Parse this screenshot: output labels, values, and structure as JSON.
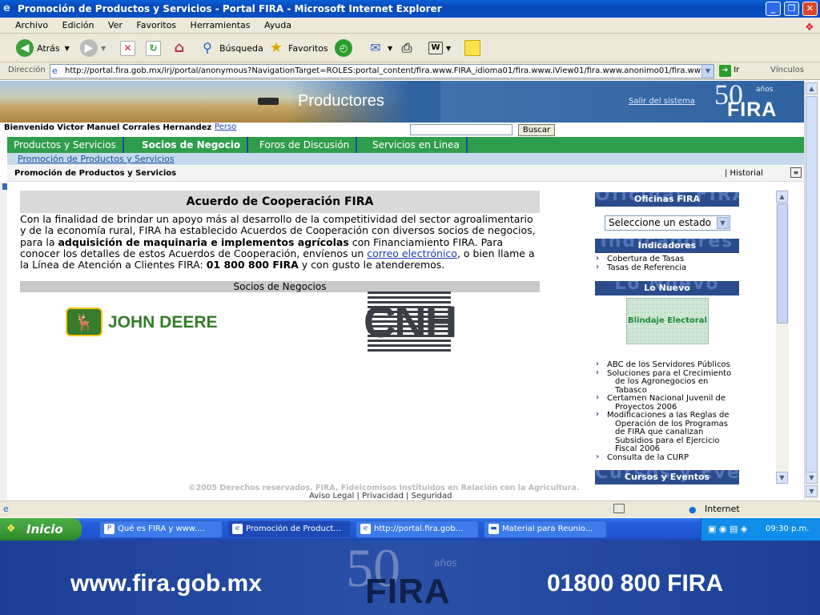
{
  "window": {
    "title": "Promoción de Productos y Servicios - Portal FIRA - Microsoft Internet Explorer",
    "buttons": {
      "minimize": "_",
      "restore": "❐",
      "close": "✕"
    }
  },
  "menu": [
    "Archivo",
    "Edición",
    "Ver",
    "Favoritos",
    "Herramientas",
    "Ayuda"
  ],
  "toolbar": {
    "back": "Atrás",
    "search": "Búsqueda",
    "favorites": "Favoritos"
  },
  "address": {
    "label": "Dirección",
    "url": "http://portal.fira.gob.mx/irj/portal/anonymous?NavigationTarget=ROLES:portal_content/fira.www.FIRA_idioma01/fira.www.iView01/fira.www.anonimo01/fira.www.",
    "go": "Ir",
    "links": "Vínculos"
  },
  "banner": {
    "title": "Productores",
    "logout": "Salir del sistema",
    "logo_years": "50",
    "logo_anos": "años",
    "logo_brand": "FIRA"
  },
  "welcome": {
    "text": "Bienvenido Victor Manuel Corrales Hernandez",
    "perso": "Perso",
    "search_button": "Buscar",
    "search_value": ""
  },
  "nav": {
    "tabs": [
      "Productos y Servicios",
      "Socios de Negocio",
      "Foros de Discusión",
      "Servicios en Linea"
    ],
    "active": "Socios de Negocio",
    "subnav": "Promoción de Productos y Servicios",
    "breadcrumb": "Promoción de Productos y Servicios",
    "historial": "|  Historial"
  },
  "content": {
    "title": "Acuerdo de Cooperación FIRA",
    "p_start": "Con la finalidad de brindar un apoyo más al desarrollo de la competitividad del sector agroalimentario y de la economía rural, FIRA ha establecido Acuerdos de Cooperación con diversos socios de negocios, para la ",
    "p_bold": "adquisición de maquinaria e implementos agrícolas",
    "p_mid": " con Financiamiento FIRA. Para conocer los detalles de estos Acuerdos de Cooperación, envíenos un ",
    "p_link": "correo electrónico",
    "p_mid2": ", o bien llame a la Línea de Atención a Clientes FIRA: ",
    "p_phone": "01 800 800 FIRA",
    "p_end": " y con gusto le atenderemos.",
    "socios_title": "Socios de Negocios",
    "partner1": "JOHN DEERE",
    "partner2": "CNH"
  },
  "sidebar": {
    "oficinas": {
      "ghost": "Oficinas FIRA",
      "label": "Oficinas FIRA"
    },
    "select_value": "Seleccione un estado",
    "indicadores": {
      "ghost": "Indicadores",
      "label": "Indicadores"
    },
    "indicadores_items": [
      "Cobertura de Tasas",
      "Tasas de Referencia"
    ],
    "nuevo": {
      "ghost": "Lo Nuevo",
      "label": "Lo Nuevo"
    },
    "blindaje": "Blindaje Electoral",
    "news": [
      [
        "ABC de los Servidores Públicos"
      ],
      [
        "Soluciones para el Crecimiento",
        "de los Agronegocios en",
        "Tabasco"
      ],
      [
        "Certamen Nacional Juvenil de",
        "Proyectos 2006"
      ],
      [
        "Modificaciones a las Reglas de",
        "Operación de los Programas",
        "de FIRA que canalizan",
        "Subsidios para el Ejercicio",
        "Fiscal 2006"
      ],
      [
        "Consulta de la CURP"
      ]
    ],
    "cursos": {
      "ghost": "Cursos y Eventos",
      "label": "Cursos y Eventos"
    }
  },
  "footer": {
    "copyright": "©2005 Derechos reservados. FIRA, Fideicomisos Instituidos en Relación con la Agricultura.",
    "links": "Aviso Legal   |   Privacidad   |   Seguridad"
  },
  "statusbar": {
    "zone": "Internet"
  },
  "taskbar": {
    "start": "Inicio",
    "tasks": [
      "Qué es FIRA y www....",
      "Promoción de Product...",
      "http://portal.fira.gob...",
      "Material para Reunio..."
    ],
    "clock": "09:30 p.m."
  },
  "slide_footer": {
    "url": "www.fira.gob.mx",
    "phone": "01800 800 FIRA",
    "logo_years": "50",
    "logo_anos": "años",
    "logo_brand": "FIRA"
  },
  "colors": {
    "nav_green": "#2f9e4c",
    "panel_blue": "#2b4c8c",
    "link_blue": "#1a3fb5",
    "footer_blue": "#1c3f96"
  }
}
